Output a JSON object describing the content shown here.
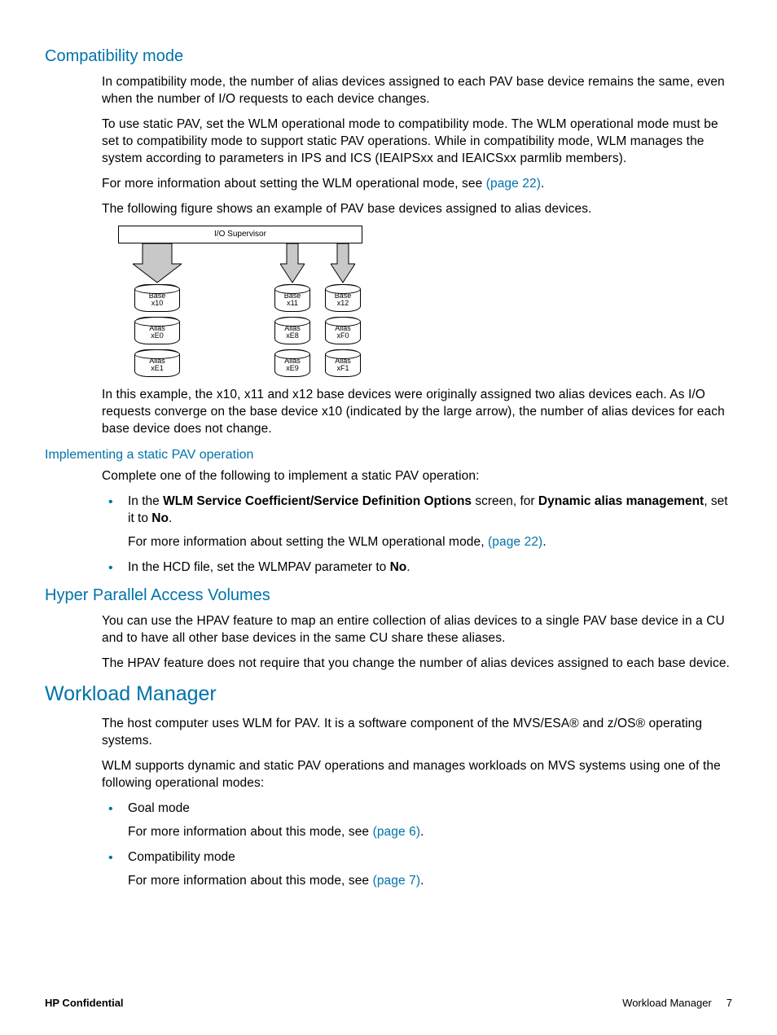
{
  "sections": {
    "compat": {
      "title": "Compatibility mode",
      "p1": "In compatibility mode, the number of alias devices assigned to each PAV base device remains the same, even when the number of I/O requests to each device changes.",
      "p2": "To use static PAV, set the WLM operational mode to compatibility mode. The WLM operational mode must be set to compatibility mode to support static PAV operations. While in compatibility mode, WLM manages the system according to parameters in IPS and ICS (IEAIPSxx and IEAICSxx parmlib members).",
      "p3a": "For more information about setting the WLM operational mode, see ",
      "p3link": "(page 22)",
      "p3b": ".",
      "p4": "The following figure shows an example of PAV base devices assigned to alias devices.",
      "p5": "In this example, the x10, x11 and x12 base devices were originally assigned two alias devices each. As I/O requests converge on the base device x10 (indicated by the large arrow), the number of alias devices for each base device does not change."
    },
    "diagram": {
      "io_supervisor": "I/O Supervisor",
      "base_l": "Base",
      "alias_l": "Alias",
      "x10": "x10",
      "x11": "x11",
      "x12": "x12",
      "xE0": "xE0",
      "xE1": "xE1",
      "xE8": "xE8",
      "xE9": "xE9",
      "xF0": "xF0",
      "xF1": "xF1"
    },
    "staticpav": {
      "title": "Implementing a static PAV operation",
      "p1": "Complete one of the following to implement a static PAV operation:",
      "b1a": "In the ",
      "b1bold1": "WLM Service Coefficient/Service Definition Options",
      "b1b": " screen, for ",
      "b1bold2": "Dynamic alias management",
      "b1c": ", set it to ",
      "b1bold3": "No",
      "b1d": ".",
      "b1pA": "For more information about setting the WLM operational mode, ",
      "b1plink": "(page 22)",
      "b1pB": ".",
      "b2a": "In the HCD file, set the WLMPAV parameter to ",
      "b2bold": "No",
      "b2b": "."
    },
    "hpav": {
      "title": "Hyper Parallel Access Volumes",
      "p1": "You can use the HPAV feature to map an entire collection of alias devices to a single PAV base device in a CU and to have all other base devices in the same CU share these aliases.",
      "p2": "The HPAV feature does not require that you change the number of alias devices assigned to each base device."
    },
    "wlm": {
      "title": "Workload Manager",
      "p1": "The host computer uses WLM for PAV. It is a software component of the MVS/ESA® and z/OS® operating systems.",
      "p2": "WLM supports dynamic and static PAV operations and manages workloads on MVS systems using one of the following operational modes:",
      "b1": "Goal mode",
      "b1pA": "For more information about this mode, see ",
      "b1plink": "(page 6)",
      "b1pB": ".",
      "b2": "Compatibility mode",
      "b2pA": "For more information about this mode, see ",
      "b2plink": "(page 7)",
      "b2pB": "."
    }
  },
  "footer": {
    "left": "HP Confidential",
    "right_label": "Workload Manager",
    "page": "7"
  }
}
